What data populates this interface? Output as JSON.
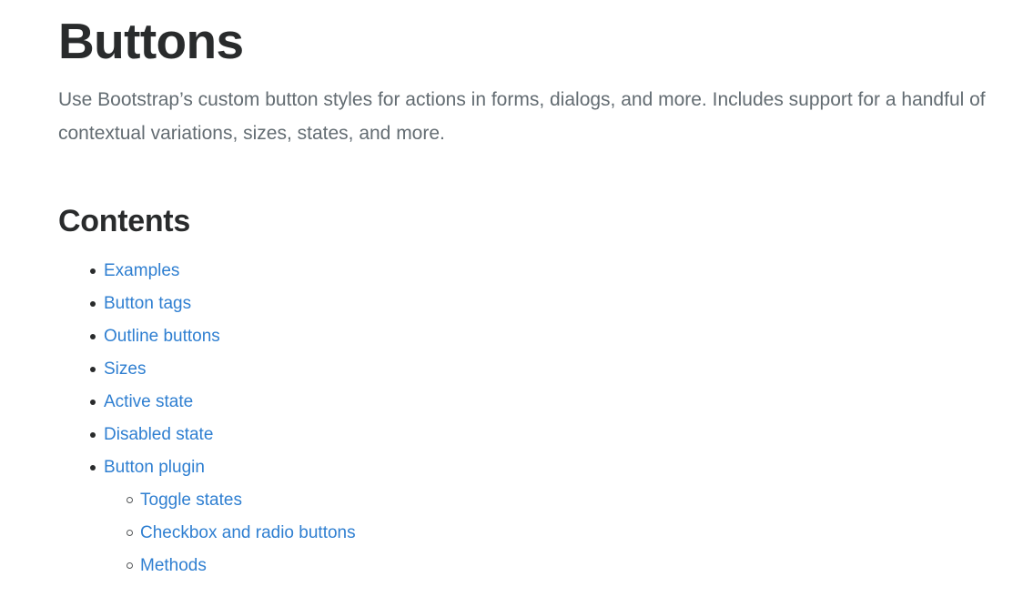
{
  "page": {
    "title": "Buttons",
    "lead": "Use Bootstrap’s custom button styles for actions in forms, dialogs, and more. Includes support for a handful of contextual variations, sizes, states, and more.",
    "contents_heading": "Contents"
  },
  "colors": {
    "link": "#2f7fd1",
    "heading": "#292b2c",
    "lead_text": "#636c72",
    "background": "#ffffff"
  },
  "toc": {
    "items": [
      {
        "label": "Examples"
      },
      {
        "label": "Button tags"
      },
      {
        "label": "Outline buttons"
      },
      {
        "label": "Sizes"
      },
      {
        "label": "Active state"
      },
      {
        "label": "Disabled state"
      },
      {
        "label": "Button plugin",
        "children": [
          {
            "label": "Toggle states"
          },
          {
            "label": "Checkbox and radio buttons"
          },
          {
            "label": "Methods"
          }
        ]
      }
    ]
  }
}
